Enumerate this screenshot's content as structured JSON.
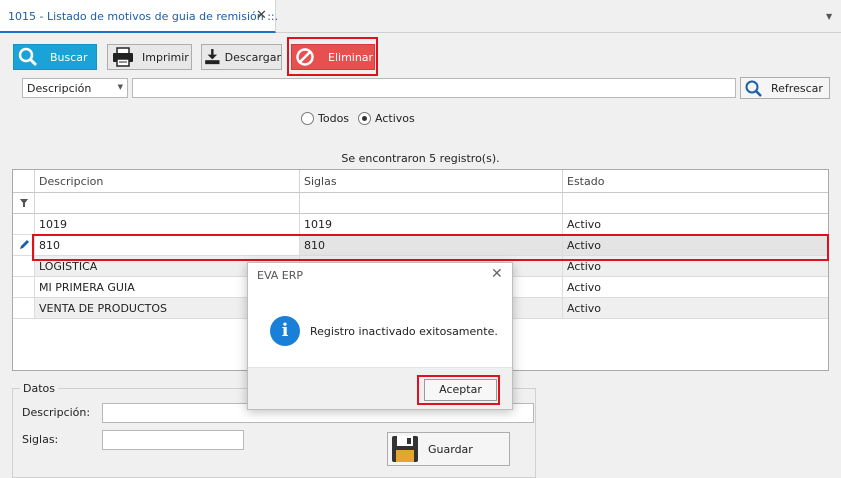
{
  "tab": {
    "title": "1015 - Listado de motivos de guia de remisión ::."
  },
  "toolbar": {
    "buscar": "Buscar",
    "imprimir": "Imprimir",
    "descargar": "Descargar",
    "eliminar": "Eliminar"
  },
  "filter": {
    "field_selected": "Descripción",
    "search_value": "",
    "refrescar": "Refrescar"
  },
  "status_filter": {
    "todos": "Todos",
    "activos": "Activos",
    "selected": "Activos"
  },
  "results_text": "Se encontraron 5 registro(s).",
  "grid": {
    "columns": [
      "Descripcion",
      "Siglas",
      "Estado"
    ],
    "rows": [
      {
        "descripcion": "1019",
        "siglas": "1019",
        "estado": "Activo"
      },
      {
        "descripcion": "810",
        "siglas": "810",
        "estado": "Activo"
      },
      {
        "descripcion": "LOGISTICA",
        "siglas": "",
        "estado": "Activo"
      },
      {
        "descripcion": "MI PRIMERA GUIA",
        "siglas": "",
        "estado": "Activo"
      },
      {
        "descripcion": "VENTA DE PRODUCTOS",
        "siglas": "",
        "estado": "Activo"
      }
    ]
  },
  "datos": {
    "title": "Datos",
    "descripcion_label": "Descripción:",
    "siglas_label": "Siglas:",
    "descripcion_value": "",
    "siglas_value": "",
    "guardar": "Guardar"
  },
  "dialog": {
    "title": "EVA ERP",
    "message": "Registro inactivado exitosamente.",
    "ok": "Aceptar"
  },
  "colors": {
    "accent_blue": "#1aa3d6",
    "danger_red": "#e85050",
    "highlight_red": "#e0101e",
    "info_blue": "#1a7fd6"
  }
}
